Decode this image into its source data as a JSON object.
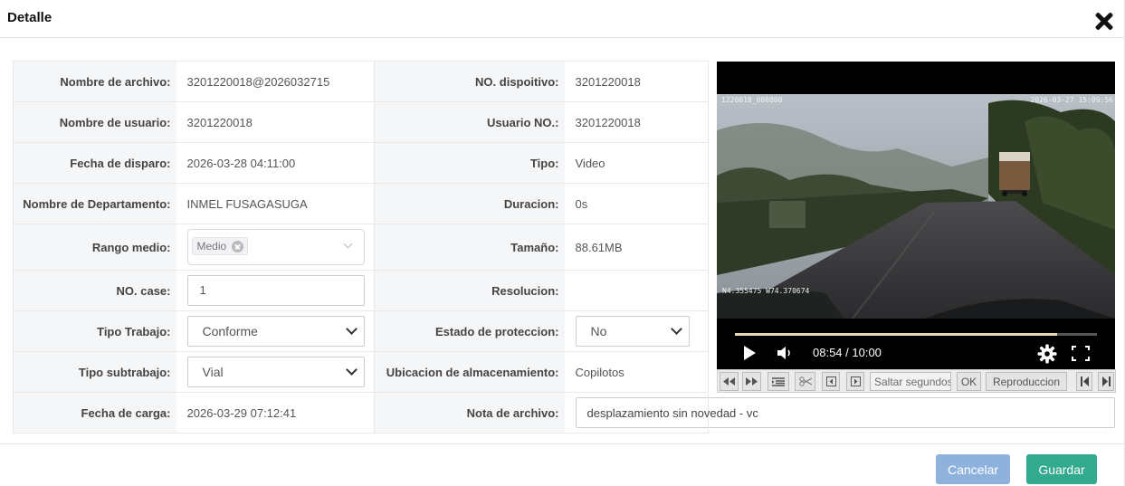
{
  "dialog": {
    "title": "Detalle"
  },
  "form": {
    "rows": [
      {
        "left_label": "Nombre de archivo:",
        "left_value": "3201220018@2026032715",
        "right_label": "NO. dispoitivo:",
        "right_value": "3201220018"
      },
      {
        "left_label": "Nombre de usuario:",
        "left_value": "3201220018",
        "right_label": "Usuario NO.:",
        "right_value": "3201220018"
      },
      {
        "left_label": "Fecha de disparo:",
        "left_value": "2026-03-28 04:11:00",
        "right_label": "Tipo:",
        "right_value": "Video"
      },
      {
        "left_label": "Nombre de Departamento:",
        "left_value": "INMEL FUSAGASUGA",
        "right_label": "Duracion:",
        "right_value": "0s"
      },
      {
        "left_label": "Rango medio:",
        "left_tag": "Medio",
        "right_label": "Tamaño:",
        "right_value": "88.61MB"
      },
      {
        "left_label": "NO. case:",
        "left_value": "1",
        "right_label": "Resolucion:",
        "right_value": ""
      },
      {
        "left_label": "Tipo Trabajo:",
        "left_value": "Conforme",
        "right_label": "Estado de proteccion:",
        "right_value": "No"
      },
      {
        "left_label": "Tipo subtrabajo:",
        "left_value": "Vial",
        "right_label": "Ubicacion de almacenamiento:",
        "right_value": "Copilotos"
      },
      {
        "left_label": "Fecha de carga:",
        "left_value": "2026-03-29 07:12:41",
        "right_label": "Nota de archivo:",
        "right_value": "desplazamiento sin novedad  - vc"
      }
    ]
  },
  "video": {
    "osd_top_left": "1220018_000000",
    "osd_top_right": "2026-03-27 15:09:56",
    "osd_coords": "N4.355475 W74.370674",
    "current_time": "08:54",
    "duration": "10:00",
    "time_display": "08:54 / 10:00",
    "progress": 0.89,
    "icons": {
      "play": "play-icon",
      "volume": "volume-icon",
      "settings": "gear-icon",
      "fullscreen": "fullscreen-icon"
    }
  },
  "toolbar": {
    "seek_placeholder": "Saltar segundos",
    "ok_label": "OK",
    "playback_label": "Reproduccion",
    "icons": [
      "rewind-icon",
      "fast-forward-icon",
      "list-icon",
      "scissors-icon",
      "frame-back-icon",
      "frame-forward-icon",
      "skip-start-icon",
      "skip-end-icon"
    ]
  },
  "footer": {
    "cancel_label": "Cancelar",
    "save_label": "Guardar"
  },
  "colors": {
    "cancel_button": "#8fb2dd",
    "save_button": "#33a98e",
    "label_bg": "#f5f6f8"
  }
}
